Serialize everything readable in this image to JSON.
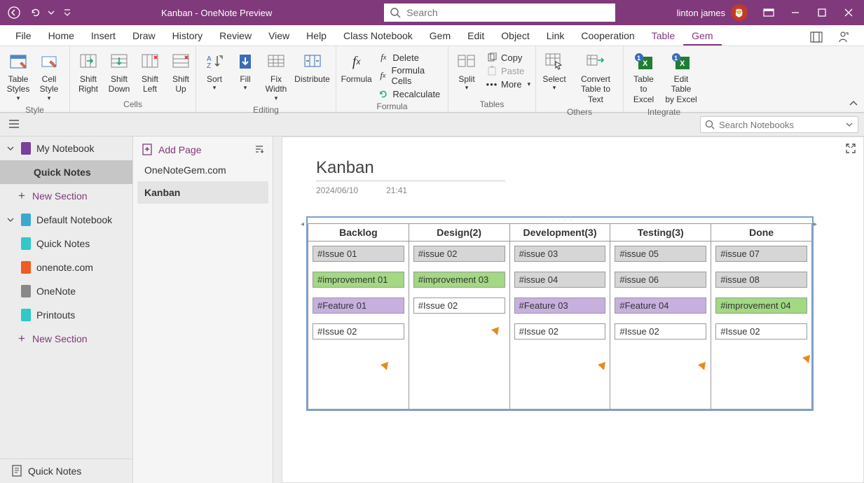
{
  "titlebar": {
    "title": "Kanban  -  OneNote Preview",
    "search_placeholder": "Search",
    "user": "linton james"
  },
  "menu": {
    "tabs": [
      "File",
      "Home",
      "Insert",
      "Draw",
      "History",
      "Review",
      "View",
      "Help",
      "Class Notebook",
      "Gem",
      "Edit",
      "Object",
      "Link",
      "Cooperation",
      "Table",
      "Gem"
    ]
  },
  "ribbon": {
    "style": {
      "label": "Style",
      "table_styles": "Table\nStyles",
      "cell_style": "Cell\nStyle"
    },
    "cells": {
      "label": "Cells",
      "shift_right": "Shift\nRight",
      "shift_down": "Shift\nDown",
      "shift_left": "Shift\nLeft",
      "shift_up": "Shift\nUp"
    },
    "editing": {
      "label": "Editing",
      "sort": "Sort",
      "fill": "Fill",
      "fix_width": "Fix\nWidth",
      "distribute": "Distribute"
    },
    "formula": {
      "label": "Formula",
      "formula": "Formula",
      "delete": "Delete",
      "cells": "Formula Cells",
      "recalc": "Recalculate"
    },
    "tables": {
      "label": "Tables",
      "split": "Split",
      "copy": "Copy",
      "paste": "Paste",
      "more": "More"
    },
    "others": {
      "label": "Others",
      "select": "Select",
      "convert": "Convert\nTable to Text"
    },
    "integrate": {
      "label": "Integrate",
      "to_excel": "Table\nto Excel",
      "by_excel": "Edit Table\nby Excel"
    }
  },
  "notebook_search": {
    "placeholder": "Search Notebooks"
  },
  "nav": {
    "my_notebook": "My Notebook",
    "quick_notes_sel": "Quick Notes",
    "new_section": "New Section",
    "default_notebook": "Default Notebook",
    "items": [
      "Quick Notes",
      "onenote.com",
      "OneNote",
      "Printouts"
    ],
    "new_section2": "New Section",
    "bottom": "Quick Notes"
  },
  "pages": {
    "add": "Add Page",
    "items": [
      "OneNoteGem.com",
      "Kanban"
    ]
  },
  "page": {
    "title": "Kanban",
    "date": "2024/06/10",
    "time": "21:41"
  },
  "kanban": {
    "headers": [
      "Backlog",
      "Design(2)",
      "Development(3)",
      "Testing(3)",
      "Done"
    ],
    "columns": [
      [
        {
          "t": "#Issue 01",
          "c": "grey"
        },
        {
          "t": "#improvement 01",
          "c": "green"
        },
        {
          "t": "#Feature 01",
          "c": "purple"
        },
        {
          "t": "#Issue 02",
          "c": "white"
        }
      ],
      [
        {
          "t": "#issue 02",
          "c": "grey"
        },
        {
          "t": "#improvement 03",
          "c": "green"
        },
        {
          "t": "#Issue 02",
          "c": "white"
        }
      ],
      [
        {
          "t": "#issue 03",
          "c": "grey"
        },
        {
          "t": "#issue 04",
          "c": "grey"
        },
        {
          "t": "#Feature 03",
          "c": "purple"
        },
        {
          "t": "#Issue 02",
          "c": "white"
        }
      ],
      [
        {
          "t": "#issue 05",
          "c": "grey"
        },
        {
          "t": "#issue 06",
          "c": "grey"
        },
        {
          "t": "#Feature 04",
          "c": "purple"
        },
        {
          "t": "#Issue 02",
          "c": "white"
        }
      ],
      [
        {
          "t": "#issue 07",
          "c": "grey"
        },
        {
          "t": "#issue 08",
          "c": "grey"
        },
        {
          "t": "#improvement 04",
          "c": "green"
        },
        {
          "t": "#Issue 02",
          "c": "white"
        }
      ]
    ]
  }
}
